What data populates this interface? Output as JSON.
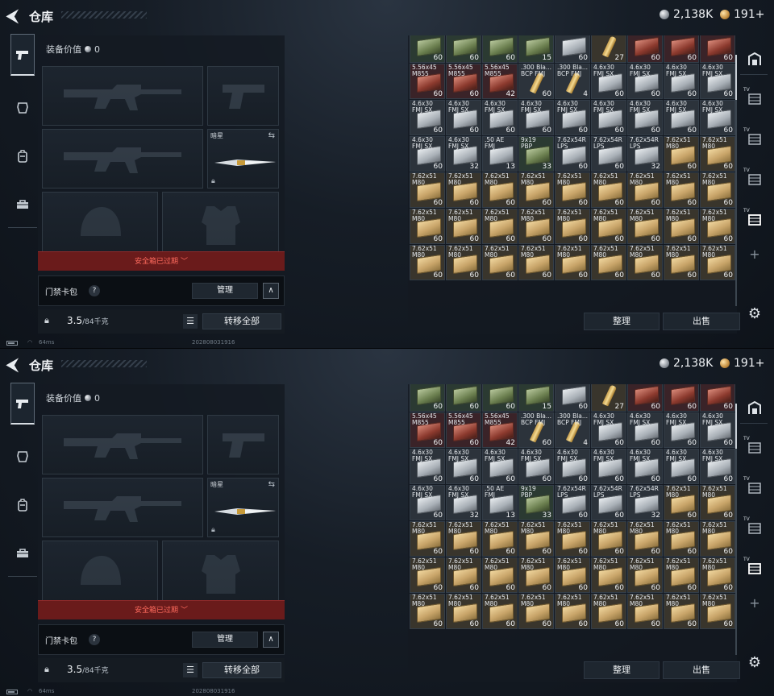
{
  "header": {
    "title": "仓库"
  },
  "currency": {
    "silver": "2,138K",
    "gold": "191+"
  },
  "loadout": {
    "equip_value_label": "装备价值",
    "equip_value": "0",
    "melee_label": "暗星",
    "safe_box_status": "安全箱已过期",
    "card_pack_label": "门禁卡包",
    "help_glyph": "?",
    "manage_label": "管理",
    "capacity_value": "3.5",
    "capacity_max": "/84千克",
    "transfer_all_label": "转移全部"
  },
  "status_bar": {
    "ping": "64ms",
    "build": "202808031916"
  },
  "stash": {
    "sort_label": "整理",
    "sell_label": "出售",
    "rows": [
      [
        {
          "label": "",
          "count": "60",
          "icon": "grnbox",
          "bg": "c-grn"
        },
        {
          "label": "",
          "count": "60",
          "icon": "grnbox",
          "bg": "c-grn"
        },
        {
          "label": "",
          "count": "60",
          "icon": "grnbox",
          "bg": "c-grn"
        },
        {
          "label": "",
          "count": "15",
          "icon": "grnbox",
          "bg": "c-grn"
        },
        {
          "label": "",
          "count": "60",
          "icon": "tin",
          "bg": "c-grey"
        },
        {
          "label": "",
          "count": "27",
          "icon": "round",
          "bg": "c-tan"
        },
        {
          "label": "",
          "count": "60",
          "icon": "redbox",
          "bg": "c-red"
        },
        {
          "label": "",
          "count": "60",
          "icon": "redbox",
          "bg": "c-red"
        },
        {
          "label": "",
          "count": "60",
          "icon": "redbox",
          "bg": "c-red"
        }
      ],
      [
        {
          "label": "5.56x45\nM855",
          "count": "60",
          "icon": "redbox",
          "bg": "c-red"
        },
        {
          "label": "5.56x45\nM855",
          "count": "60",
          "icon": "redbox",
          "bg": "c-red"
        },
        {
          "label": "5.56x45\nM855",
          "count": "42",
          "icon": "redbox",
          "bg": "c-red"
        },
        {
          "label": ".300 Bla...\nBCP FMJ",
          "count": "60",
          "icon": "round",
          "bg": "c-grey"
        },
        {
          "label": ".300 Bla...\nBCP FMJ",
          "count": "4",
          "icon": "round",
          "bg": "c-grey"
        },
        {
          "label": "4.6x30\nFMJ SX",
          "count": "60",
          "icon": "tin",
          "bg": "c-grey"
        },
        {
          "label": "4.6x30\nFMJ SX",
          "count": "60",
          "icon": "tin",
          "bg": "c-grey"
        },
        {
          "label": "4.6x30\nFMJ SX",
          "count": "60",
          "icon": "tin",
          "bg": "c-grey"
        },
        {
          "label": "4.6x30\nFMJ SX",
          "count": "60",
          "icon": "tin",
          "bg": "c-grey"
        }
      ],
      [
        {
          "label": "4.6x30\nFMJ SX",
          "count": "60",
          "icon": "tin",
          "bg": "c-grey"
        },
        {
          "label": "4.6x30\nFMJ SX",
          "count": "60",
          "icon": "tin",
          "bg": "c-grey"
        },
        {
          "label": "4.6x30\nFMJ SX",
          "count": "60",
          "icon": "tin",
          "bg": "c-grey"
        },
        {
          "label": "4.6x30\nFMJ SX",
          "count": "60",
          "icon": "tin",
          "bg": "c-grey"
        },
        {
          "label": "4.6x30\nFMJ SX",
          "count": "60",
          "icon": "tin",
          "bg": "c-grey"
        },
        {
          "label": "4.6x30\nFMJ SX",
          "count": "60",
          "icon": "tin",
          "bg": "c-grey"
        },
        {
          "label": "4.6x30\nFMJ SX",
          "count": "60",
          "icon": "tin",
          "bg": "c-grey"
        },
        {
          "label": "4.6x30\nFMJ SX",
          "count": "60",
          "icon": "tin",
          "bg": "c-grey"
        },
        {
          "label": "4.6x30\nFMJ SX",
          "count": "60",
          "icon": "tin",
          "bg": "c-grey"
        }
      ],
      [
        {
          "label": "4.6x30\nFMJ SX",
          "count": "60",
          "icon": "tin",
          "bg": "c-grey"
        },
        {
          "label": "4.6x30\nFMJ SX",
          "count": "32",
          "icon": "tin",
          "bg": "c-grey"
        },
        {
          "label": ".50 AE\nFMJ",
          "count": "13",
          "icon": "tin",
          "bg": "c-grey"
        },
        {
          "label": "9x19\nPBP",
          "count": "33",
          "icon": "grnbox",
          "bg": "c-grn"
        },
        {
          "label": "7.62x54R\nLPS",
          "count": "60",
          "icon": "tin",
          "bg": "c-grey"
        },
        {
          "label": "7.62x54R\nLPS",
          "count": "60",
          "icon": "tin",
          "bg": "c-grey"
        },
        {
          "label": "7.62x54R\nLPS",
          "count": "32",
          "icon": "tin",
          "bg": "c-grey"
        },
        {
          "label": "7.62x51\nM80",
          "count": "60",
          "icon": "box",
          "bg": "c-tan"
        },
        {
          "label": "7.62x51\nM80",
          "count": "60",
          "icon": "box",
          "bg": "c-tan"
        }
      ],
      [
        {
          "label": "7.62x51\nM80",
          "count": "60",
          "icon": "box",
          "bg": "c-tan"
        },
        {
          "label": "7.62x51\nM80",
          "count": "60",
          "icon": "box",
          "bg": "c-tan"
        },
        {
          "label": "7.62x51\nM80",
          "count": "60",
          "icon": "box",
          "bg": "c-tan"
        },
        {
          "label": "7.62x51\nM80",
          "count": "60",
          "icon": "box",
          "bg": "c-tan"
        },
        {
          "label": "7.62x51\nM80",
          "count": "60",
          "icon": "box",
          "bg": "c-tan"
        },
        {
          "label": "7.62x51\nM80",
          "count": "60",
          "icon": "box",
          "bg": "c-tan"
        },
        {
          "label": "7.62x51\nM80",
          "count": "60",
          "icon": "box",
          "bg": "c-tan"
        },
        {
          "label": "7.62x51\nM80",
          "count": "60",
          "icon": "box",
          "bg": "c-tan"
        },
        {
          "label": "7.62x51\nM80",
          "count": "60",
          "icon": "box",
          "bg": "c-tan"
        }
      ],
      [
        {
          "label": "7.62x51\nM80",
          "count": "60",
          "icon": "box",
          "bg": "c-tan"
        },
        {
          "label": "7.62x51\nM80",
          "count": "60",
          "icon": "box",
          "bg": "c-tan"
        },
        {
          "label": "7.62x51\nM80",
          "count": "60",
          "icon": "box",
          "bg": "c-tan"
        },
        {
          "label": "7.62x51\nM80",
          "count": "60",
          "icon": "box",
          "bg": "c-tan"
        },
        {
          "label": "7.62x51\nM80",
          "count": "60",
          "icon": "box",
          "bg": "c-tan"
        },
        {
          "label": "7.62x51\nM80",
          "count": "60",
          "icon": "box",
          "bg": "c-tan"
        },
        {
          "label": "7.62x51\nM80",
          "count": "60",
          "icon": "box",
          "bg": "c-tan"
        },
        {
          "label": "7.62x51\nM80",
          "count": "60",
          "icon": "box",
          "bg": "c-tan"
        },
        {
          "label": "7.62x51\nM80",
          "count": "60",
          "icon": "box",
          "bg": "c-tan"
        }
      ],
      [
        {
          "label": "7.62x51\nM80",
          "count": "60",
          "icon": "box",
          "bg": "c-tan"
        },
        {
          "label": "7.62x51\nM80",
          "count": "60",
          "icon": "box",
          "bg": "c-tan"
        },
        {
          "label": "7.62x51\nM80",
          "count": "60",
          "icon": "box",
          "bg": "c-tan"
        },
        {
          "label": "7.62x51\nM80",
          "count": "60",
          "icon": "box",
          "bg": "c-tan"
        },
        {
          "label": "7.62x51\nM80",
          "count": "60",
          "icon": "box",
          "bg": "c-tan"
        },
        {
          "label": "7.62x51\nM80",
          "count": "60",
          "icon": "box",
          "bg": "c-tan"
        },
        {
          "label": "7.62x51\nM80",
          "count": "60",
          "icon": "box",
          "bg": "c-tan"
        },
        {
          "label": "7.62x51\nM80",
          "count": "60",
          "icon": "box",
          "bg": "c-tan"
        },
        {
          "label": "7.62x51\nM80",
          "count": "60",
          "icon": "box",
          "bg": "c-tan"
        }
      ]
    ]
  }
}
